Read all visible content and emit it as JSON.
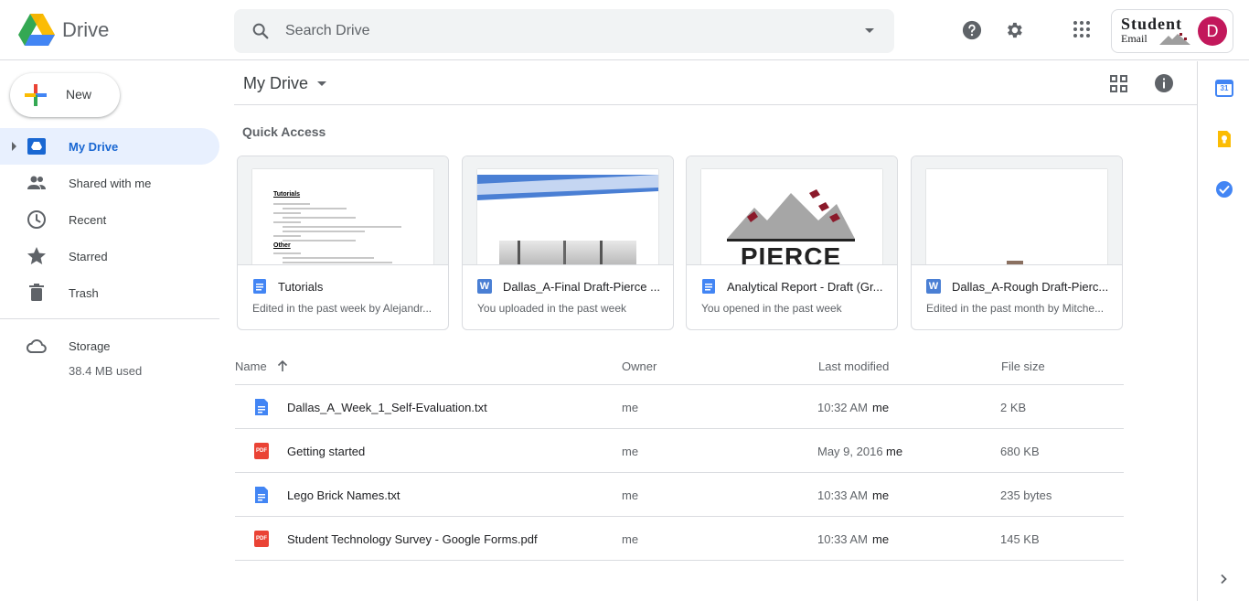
{
  "app": {
    "name": "Drive"
  },
  "search": {
    "placeholder": "Search Drive"
  },
  "account": {
    "brand_line1": "Student",
    "brand_line2": "Email",
    "avatar_letter": "D",
    "avatar_color": "#c2185b"
  },
  "sidebar": {
    "new_label": "New",
    "items": [
      {
        "label": "My Drive",
        "icon": "my-drive-icon",
        "active": true
      },
      {
        "label": "Shared with me",
        "icon": "people-icon"
      },
      {
        "label": "Recent",
        "icon": "clock-icon"
      },
      {
        "label": "Starred",
        "icon": "star-icon"
      },
      {
        "label": "Trash",
        "icon": "trash-icon"
      }
    ],
    "storage": {
      "label": "Storage",
      "used": "38.4 MB used",
      "icon": "cloud-icon"
    }
  },
  "main": {
    "breadcrumb": "My Drive",
    "quick_access_title": "Quick Access",
    "quick_access": [
      {
        "name": "Tutorials",
        "sub": "Edited in the past week by Alejandr...",
        "type": "docs"
      },
      {
        "name": "Dallas_A-Final Draft-Pierce ...",
        "sub": "You uploaded in the past week",
        "type": "word"
      },
      {
        "name": "Analytical Report - Draft (Gr...",
        "sub": "You opened in the past week",
        "type": "docs"
      },
      {
        "name": "Dallas_A-Rough Draft-Pierc...",
        "sub": "Edited in the past month by Mitche...",
        "type": "word"
      }
    ],
    "thumb_texts": {
      "tutorials_heading": "Tutorials",
      "tutorials_other": "Other",
      "pierce_logo": "PIERCE"
    },
    "table": {
      "headers": {
        "name": "Name",
        "owner": "Owner",
        "modified": "Last modified",
        "size": "File size"
      },
      "rows": [
        {
          "name": "Dallas_A_Week_1_Self-Evaluation.txt",
          "type": "docs",
          "owner": "me",
          "modified": "10:32 AM",
          "modified_by": "me",
          "size": "2 KB"
        },
        {
          "name": "Getting started",
          "type": "pdf",
          "owner": "me",
          "modified": "May 9, 2016",
          "modified_by": "me",
          "size": "680 KB"
        },
        {
          "name": "Lego Brick Names.txt",
          "type": "docs",
          "owner": "me",
          "modified": "10:33 AM",
          "modified_by": "me",
          "size": "235 bytes"
        },
        {
          "name": "Student Technology Survey - Google Forms.pdf",
          "type": "pdf",
          "owner": "me",
          "modified": "10:33 AM",
          "modified_by": "me",
          "size": "145 KB"
        }
      ]
    }
  },
  "icons": {
    "pdf_label": "PDF",
    "word_letter": "W"
  },
  "right_panel": {
    "calendar_day": "31"
  },
  "colors": {
    "accent": "#1967d2",
    "active_bg": "#e8f0fe",
    "pdf": "#ea4335",
    "docs": "#4285f4"
  }
}
